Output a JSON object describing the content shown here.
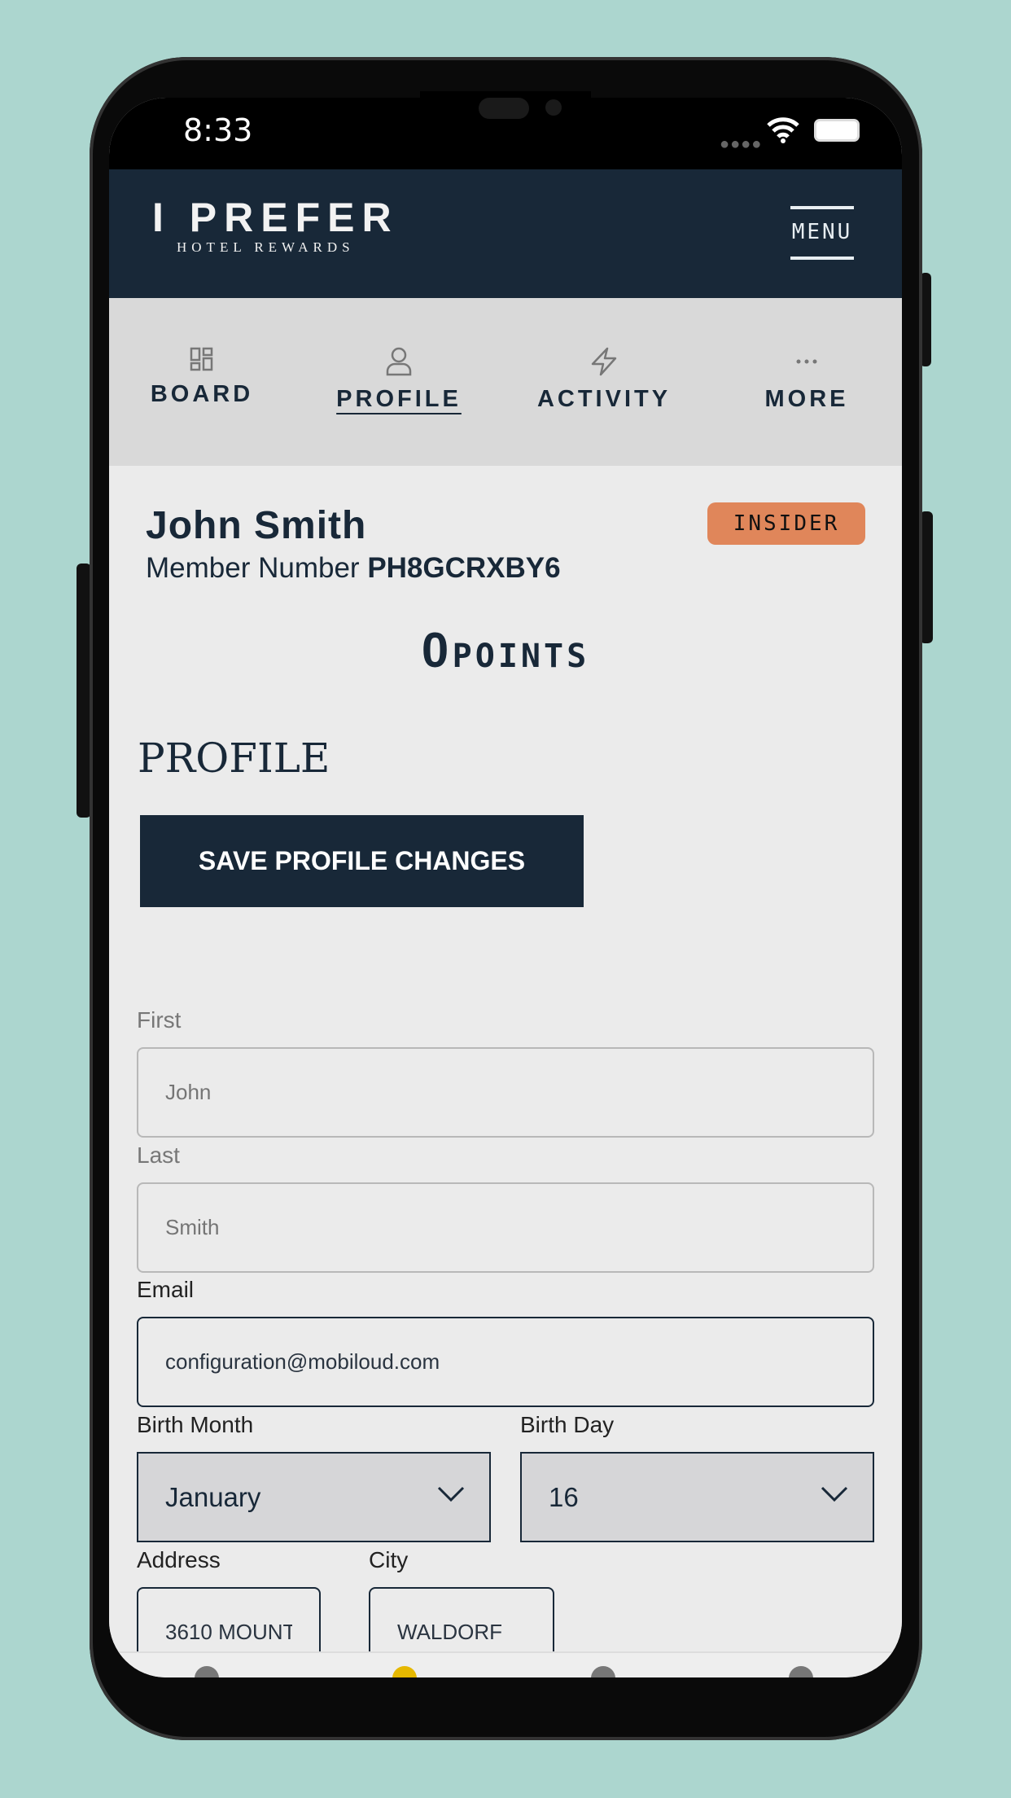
{
  "status": {
    "time": "8:33"
  },
  "header": {
    "logo_main": "I PREFER",
    "logo_sub": "HOTEL REWARDS",
    "menu_label": "MENU"
  },
  "tabs": [
    {
      "label": "BOARD",
      "icon": "grid-icon"
    },
    {
      "label": "PROFILE",
      "icon": "user-icon",
      "active": true
    },
    {
      "label": "ACTIVITY",
      "icon": "lightning-icon"
    },
    {
      "label": "MORE",
      "icon": "more-icon"
    }
  ],
  "member": {
    "name": "John Smith",
    "number_label": "Member Number",
    "number": "PH8GCRXBY6",
    "tier": "INSIDER",
    "points": "0",
    "points_unit": "POINTS"
  },
  "profile": {
    "title": "PROFILE",
    "save_label": "SAVE PROFILE CHANGES"
  },
  "form": {
    "first_label": "First",
    "first_placeholder": "John",
    "last_label": "Last",
    "last_placeholder": "Smith",
    "email_label": "Email",
    "email_value": "configuration@mobiloud.com",
    "birth_month_label": "Birth Month",
    "birth_month_value": "January",
    "birth_day_label": "Birth Day",
    "birth_day_value": "16",
    "address_label": "Address",
    "address_value": "3610 MOUNT",
    "city_label": "City",
    "city_value": "WALDORF"
  },
  "colors": {
    "navy": "#182838",
    "badge": "#e0865a",
    "background": "#acd6cf"
  }
}
